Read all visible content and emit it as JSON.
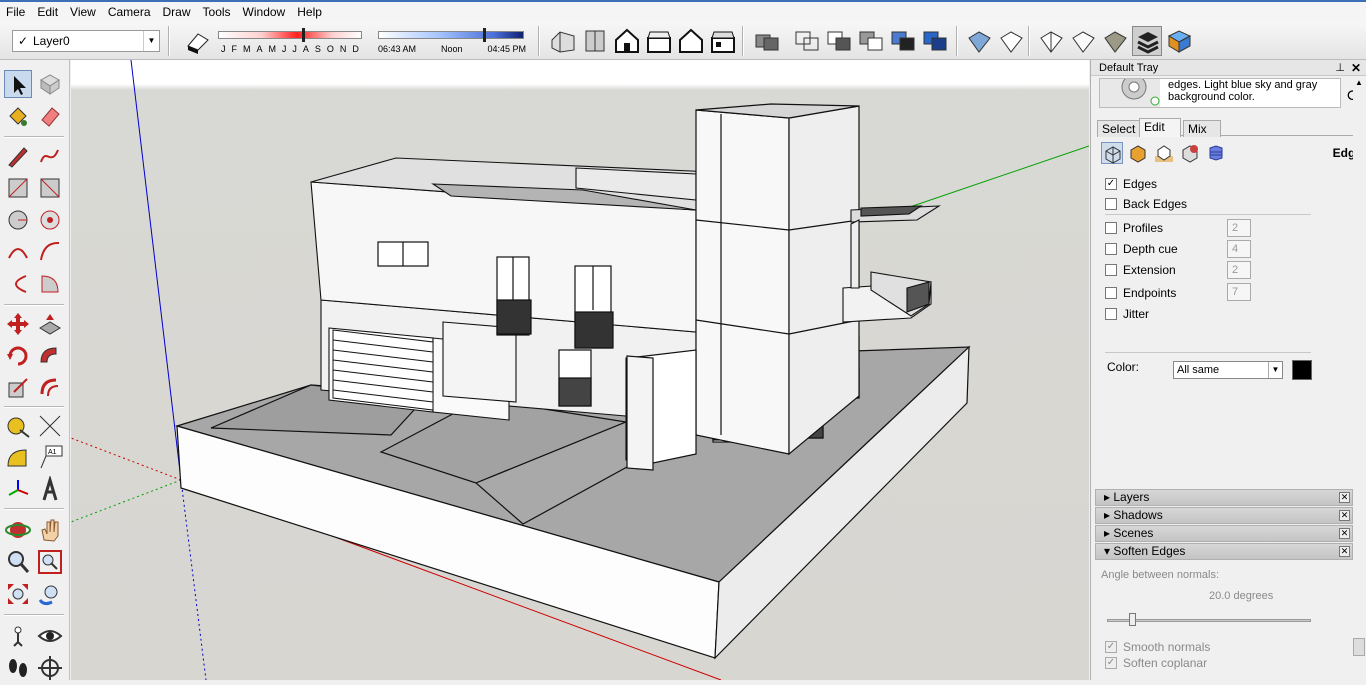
{
  "menu": [
    "File",
    "Edit",
    "View",
    "Camera",
    "Draw",
    "Tools",
    "Window",
    "Help"
  ],
  "toolbar": {
    "layer_checkmark": "✓",
    "layer_name": "Layer0",
    "months": [
      "J",
      "F",
      "M",
      "A",
      "M",
      "J",
      "J",
      "A",
      "S",
      "O",
      "N",
      "D"
    ],
    "month_value": 0.58,
    "time_start": "06:43 AM",
    "time_mid": "Noon",
    "time_end": "04:45 PM",
    "time_value": 0.72
  },
  "tray": {
    "title": "Default Tray",
    "pin": "⊥",
    "close": "✕",
    "style_description": "edges. Light blue sky and gray background color.",
    "refresh": "⟳",
    "tabs": [
      "Select",
      "Edit",
      "Mix"
    ],
    "active_tab": "Edit",
    "section_title": "Edge",
    "edge_options": [
      {
        "label": "Edges",
        "checked": true,
        "value": ""
      },
      {
        "label": "Back Edges",
        "checked": false,
        "value": ""
      },
      {
        "label": "Profiles",
        "checked": false,
        "value": "2"
      },
      {
        "label": "Depth cue",
        "checked": false,
        "value": "4"
      },
      {
        "label": "Extension",
        "checked": false,
        "value": "2"
      },
      {
        "label": "Endpoints",
        "checked": false,
        "value": "7"
      },
      {
        "label": "Jitter",
        "checked": false,
        "value": ""
      }
    ],
    "color_label": "Color:",
    "color_value": "All same",
    "color_swatch": "#000000",
    "panels": [
      "Layers",
      "Shadows",
      "Scenes",
      "Soft Edges"
    ],
    "panels_expanded": "Soft Edges",
    "soften_edges_label": "Soften Edges",
    "soft": {
      "angle_label": "Angle between normals:",
      "angle_value": "20.0  degrees",
      "slider_value": 0.11,
      "smooth_normals": "Smooth normals",
      "soften_coplanar": "Soften coplanar"
    }
  },
  "colors": {
    "accent": "#3b6fb6",
    "axis_red": "#cc0000",
    "axis_green": "#00a000",
    "axis_blue": "#0000cc",
    "viewport_bg": "#d7d6d1"
  }
}
